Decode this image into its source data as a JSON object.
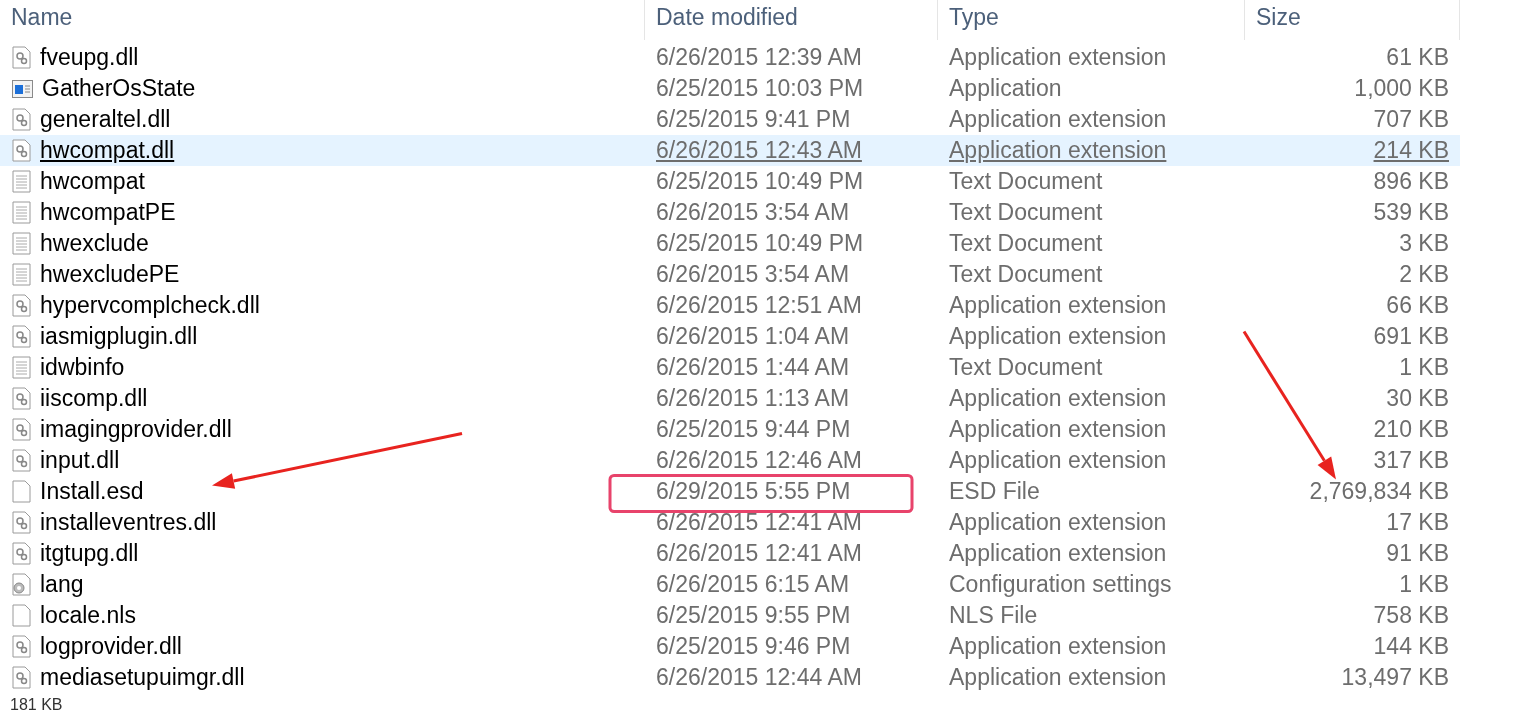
{
  "columns": [
    {
      "label": "Name"
    },
    {
      "label": "Date modified"
    },
    {
      "label": "Type"
    },
    {
      "label": "Size"
    }
  ],
  "rows": [
    {
      "kind": "dll",
      "name": "fveupg.dll",
      "date": "6/26/2015 12:39 AM",
      "type": "Application extension",
      "size": "61 KB",
      "hovered": false,
      "annotated": false
    },
    {
      "kind": "app",
      "name": "GatherOsState",
      "date": "6/25/2015 10:03 PM",
      "type": "Application",
      "size": "1,000 KB",
      "hovered": false,
      "annotated": false
    },
    {
      "kind": "dll",
      "name": "generaltel.dll",
      "date": "6/25/2015 9:41 PM",
      "type": "Application extension",
      "size": "707 KB",
      "hovered": false,
      "annotated": false
    },
    {
      "kind": "dll",
      "name": "hwcompat.dll",
      "date": "6/26/2015 12:43 AM",
      "type": "Application extension",
      "size": "214 KB",
      "hovered": true,
      "annotated": false
    },
    {
      "kind": "text",
      "name": "hwcompat",
      "date": "6/25/2015 10:49 PM",
      "type": "Text Document",
      "size": "896 KB",
      "hovered": false,
      "annotated": false
    },
    {
      "kind": "text",
      "name": "hwcompatPE",
      "date": "6/26/2015 3:54 AM",
      "type": "Text Document",
      "size": "539 KB",
      "hovered": false,
      "annotated": false
    },
    {
      "kind": "text",
      "name": "hwexclude",
      "date": "6/25/2015 10:49 PM",
      "type": "Text Document",
      "size": "3 KB",
      "hovered": false,
      "annotated": false
    },
    {
      "kind": "text",
      "name": "hwexcludePE",
      "date": "6/26/2015 3:54 AM",
      "type": "Text Document",
      "size": "2 KB",
      "hovered": false,
      "annotated": false
    },
    {
      "kind": "dll",
      "name": "hypervcomplcheck.dll",
      "date": "6/26/2015 12:51 AM",
      "type": "Application extension",
      "size": "66 KB",
      "hovered": false,
      "annotated": false
    },
    {
      "kind": "dll",
      "name": "iasmigplugin.dll",
      "date": "6/26/2015 1:04 AM",
      "type": "Application extension",
      "size": "691 KB",
      "hovered": false,
      "annotated": false
    },
    {
      "kind": "text",
      "name": "idwbinfo",
      "date": "6/26/2015 1:44 AM",
      "type": "Text Document",
      "size": "1 KB",
      "hovered": false,
      "annotated": false
    },
    {
      "kind": "dll",
      "name": "iiscomp.dll",
      "date": "6/26/2015 1:13 AM",
      "type": "Application extension",
      "size": "30 KB",
      "hovered": false,
      "annotated": false
    },
    {
      "kind": "dll",
      "name": "imagingprovider.dll",
      "date": "6/25/2015 9:44 PM",
      "type": "Application extension",
      "size": "210 KB",
      "hovered": false,
      "annotated": false
    },
    {
      "kind": "dll",
      "name": "input.dll",
      "date": "6/26/2015 12:46 AM",
      "type": "Application extension",
      "size": "317 KB",
      "hovered": false,
      "annotated": false
    },
    {
      "kind": "blank",
      "name": "Install.esd",
      "date": "6/29/2015 5:55 PM",
      "type": "ESD File",
      "size": "2,769,834 KB",
      "hovered": false,
      "annotated": true
    },
    {
      "kind": "dll",
      "name": "installeventres.dll",
      "date": "6/26/2015 12:41 AM",
      "type": "Application extension",
      "size": "17 KB",
      "hovered": false,
      "annotated": false
    },
    {
      "kind": "dll",
      "name": "itgtupg.dll",
      "date": "6/26/2015 12:41 AM",
      "type": "Application extension",
      "size": "91 KB",
      "hovered": false,
      "annotated": false
    },
    {
      "kind": "config",
      "name": "lang",
      "date": "6/26/2015 6:15 AM",
      "type": "Configuration settings",
      "size": "1 KB",
      "hovered": false,
      "annotated": false
    },
    {
      "kind": "blank",
      "name": "locale.nls",
      "date": "6/25/2015 9:55 PM",
      "type": "NLS File",
      "size": "758 KB",
      "hovered": false,
      "annotated": false
    },
    {
      "kind": "dll",
      "name": "logprovider.dll",
      "date": "6/25/2015 9:46 PM",
      "type": "Application extension",
      "size": "144 KB",
      "hovered": false,
      "annotated": false
    },
    {
      "kind": "dll",
      "name": "mediasetupuimgr.dll",
      "date": "6/26/2015 12:44 AM",
      "type": "Application extension",
      "size": "13,497 KB",
      "hovered": false,
      "annotated": false
    }
  ],
  "status_bar": {
    "text": "181 KB"
  }
}
